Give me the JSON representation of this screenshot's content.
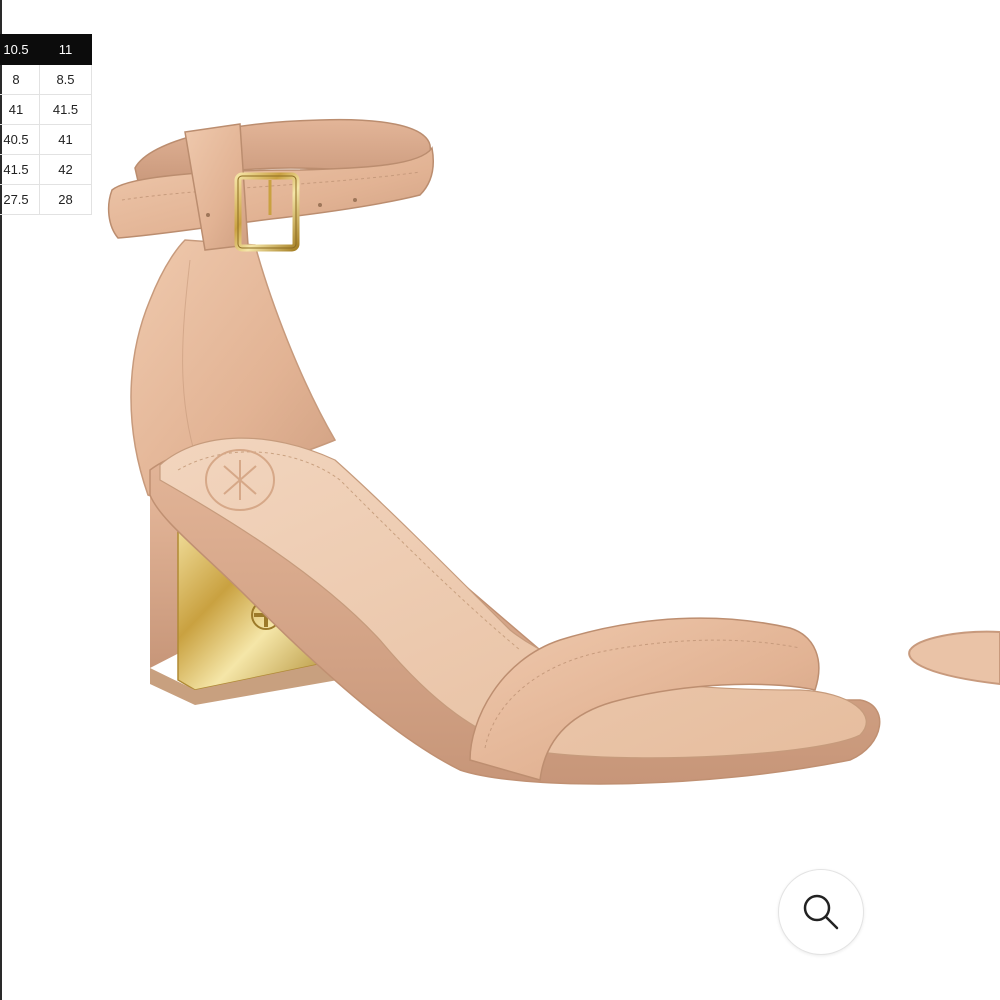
{
  "size_chart": {
    "header": [
      "10.5",
      "11"
    ],
    "rows": [
      [
        "8",
        "8.5"
      ],
      [
        "41",
        "41.5"
      ],
      [
        "40.5",
        "41"
      ],
      [
        "41.5",
        "42"
      ],
      [
        "27.5",
        "28"
      ]
    ]
  },
  "product_image": {
    "subject": "nude leather ankle-strap block-heel sandal",
    "colors": {
      "leather": "#e4b79a",
      "leather_shadow": "#c99a7c",
      "gold": "#d9b75a",
      "insole": "#efcfb6"
    }
  },
  "zoom_button": {
    "icon": "magnifier-icon"
  }
}
